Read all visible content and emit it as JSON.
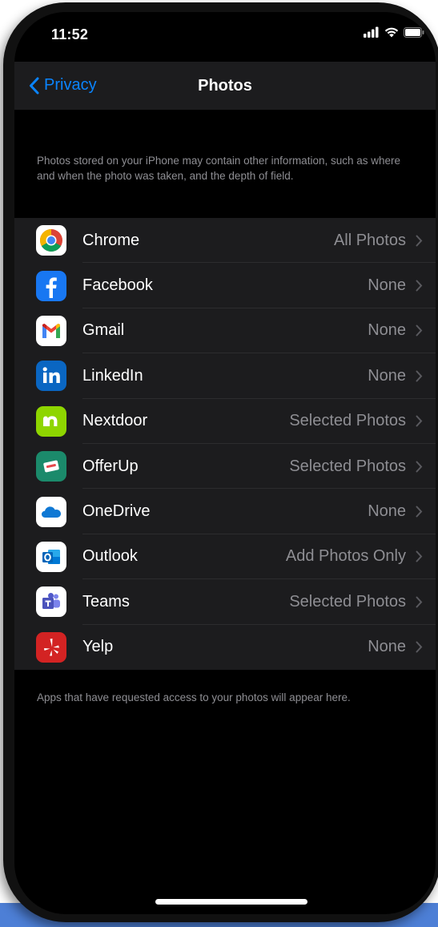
{
  "status": {
    "time": "11:52"
  },
  "nav": {
    "back_label": "Privacy",
    "title": "Photos"
  },
  "description": "Photos stored on your iPhone may contain other information, such as where and when the photo was taken, and the depth of field.",
  "apps": [
    {
      "name": "Chrome",
      "value": "All Photos",
      "icon": "chrome-icon"
    },
    {
      "name": "Facebook",
      "value": "None",
      "icon": "facebook-icon"
    },
    {
      "name": "Gmail",
      "value": "None",
      "icon": "gmail-icon"
    },
    {
      "name": "LinkedIn",
      "value": "None",
      "icon": "linkedin-icon"
    },
    {
      "name": "Nextdoor",
      "value": "Selected Photos",
      "icon": "nextdoor-icon"
    },
    {
      "name": "OfferUp",
      "value": "Selected Photos",
      "icon": "offerup-icon"
    },
    {
      "name": "OneDrive",
      "value": "None",
      "icon": "onedrive-icon"
    },
    {
      "name": "Outlook",
      "value": "Add Photos Only",
      "icon": "outlook-icon"
    },
    {
      "name": "Teams",
      "value": "Selected Photos",
      "icon": "teams-icon"
    },
    {
      "name": "Yelp",
      "value": "None",
      "icon": "yelp-icon"
    }
  ],
  "footer": "Apps that have requested access to your photos will appear here.",
  "colors": {
    "accent": "#0a84ff",
    "background": "#000000",
    "cell": "#1c1c1e",
    "secondary_text": "#8e8e93"
  }
}
